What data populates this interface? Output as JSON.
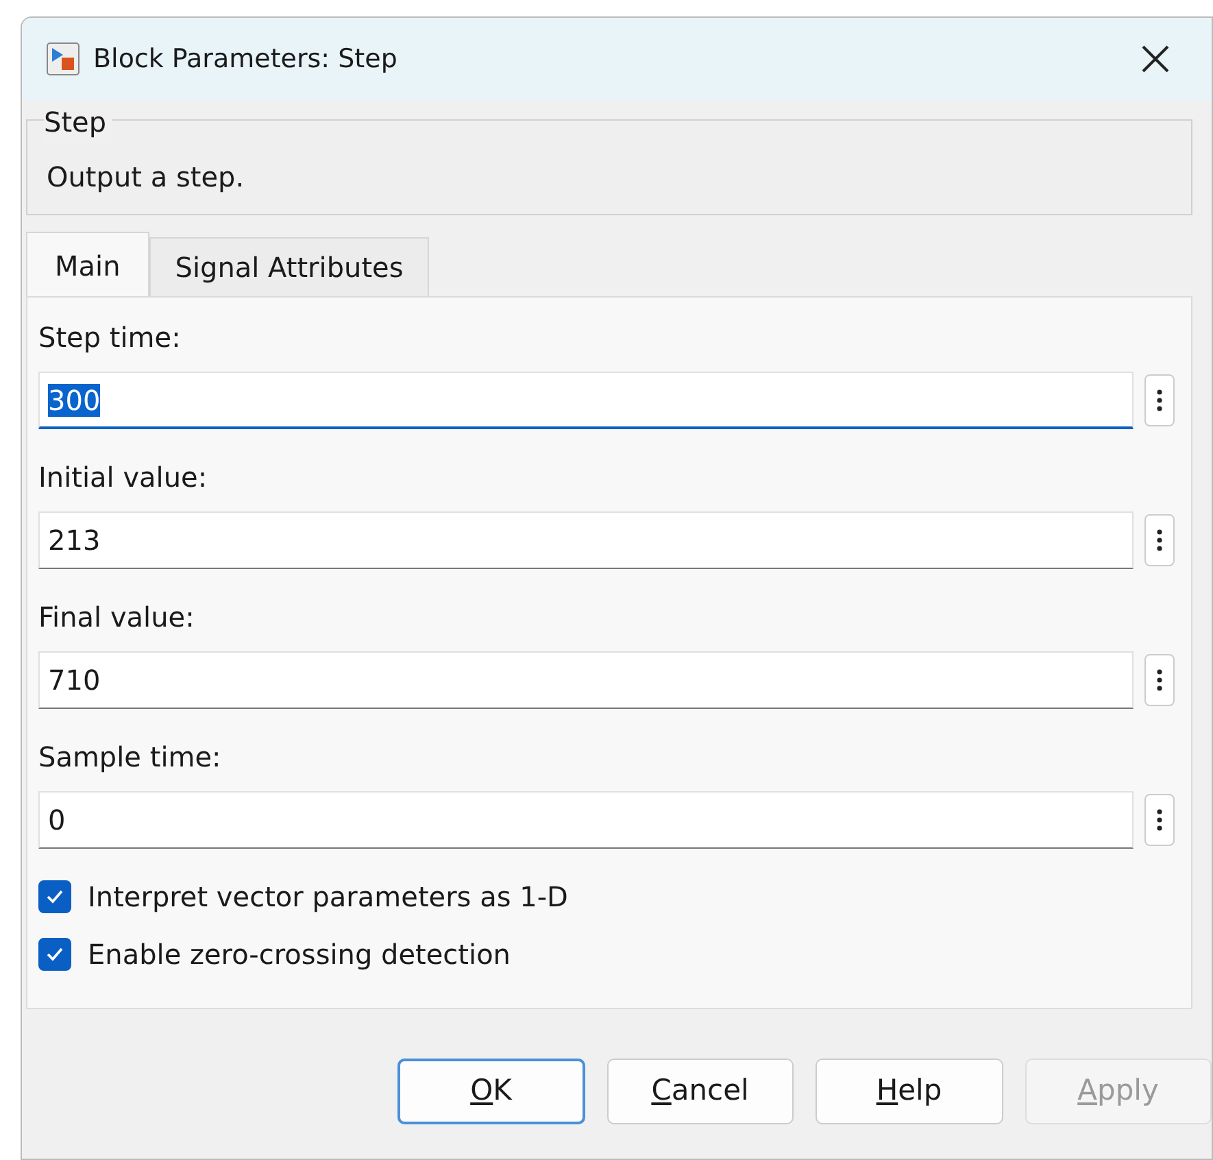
{
  "window": {
    "title": "Block Parameters: Step"
  },
  "group": {
    "title": "Step",
    "description": "Output a step."
  },
  "tabs": [
    {
      "label": "Main",
      "selected": true
    },
    {
      "label": "Signal Attributes",
      "selected": false
    }
  ],
  "fields": [
    {
      "label": "Step time:",
      "value": "300",
      "focused": true
    },
    {
      "label": "Initial value:",
      "value": "213",
      "focused": false
    },
    {
      "label": "Final value:",
      "value": "710",
      "focused": false
    },
    {
      "label": "Sample time:",
      "value": "0",
      "focused": false
    }
  ],
  "checkboxes": [
    {
      "label": "Interpret vector parameters as 1-D",
      "checked": true
    },
    {
      "label": "Enable zero-crossing detection",
      "checked": true
    }
  ],
  "buttons": [
    {
      "label": "OK",
      "default": true,
      "disabled": false,
      "underline_first": true
    },
    {
      "label": "Cancel",
      "default": false,
      "disabled": false,
      "underline_first": true
    },
    {
      "label": "Help",
      "default": false,
      "disabled": false,
      "underline_first": true
    },
    {
      "label": "Apply",
      "default": false,
      "disabled": true,
      "underline_first": true
    }
  ]
}
